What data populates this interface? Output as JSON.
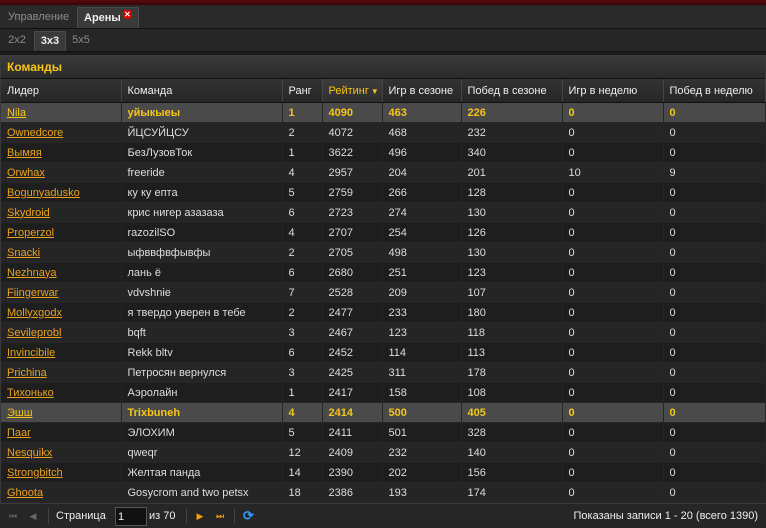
{
  "tabs": [
    {
      "label": "Управление"
    },
    {
      "label": "Арены",
      "closable": true
    }
  ],
  "subtabs": [
    "2x2",
    "3x3",
    "5x5"
  ],
  "active_subtab": "3x3",
  "panel_title": "Команды",
  "columns": [
    "Лидер",
    "Команда",
    "Ранг",
    "Рейтинг",
    "Игр в сезоне",
    "Побед в сезоне",
    "Игр в неделю",
    "Побед в неделю"
  ],
  "sorted_column": "Рейтинг",
  "rows": [
    {
      "leader": "Nila",
      "team": "уйыкыеы",
      "rank": "1",
      "rating": "4090",
      "season_games": "463",
      "season_wins": "226",
      "week_games": "0",
      "week_wins": "0",
      "highlight": true
    },
    {
      "leader": "Ownedcore",
      "team": "ЙЦСУЙЦСУ",
      "rank": "2",
      "rating": "4072",
      "season_games": "468",
      "season_wins": "232",
      "week_games": "0",
      "week_wins": "0"
    },
    {
      "leader": "Вымяя",
      "team": "БезЛузовТок",
      "rank": "1",
      "rating": "3622",
      "season_games": "496",
      "season_wins": "340",
      "week_games": "0",
      "week_wins": "0"
    },
    {
      "leader": "Orwhax",
      "team": "freeride",
      "rank": "4",
      "rating": "2957",
      "season_games": "204",
      "season_wins": "201",
      "week_games": "10",
      "week_wins": "9"
    },
    {
      "leader": "Bogunyadusko",
      "team": "ку ку епта",
      "rank": "5",
      "rating": "2759",
      "season_games": "266",
      "season_wins": "128",
      "week_games": "0",
      "week_wins": "0"
    },
    {
      "leader": "Skydroid",
      "team": "крис нигер азазаза",
      "rank": "6",
      "rating": "2723",
      "season_games": "274",
      "season_wins": "130",
      "week_games": "0",
      "week_wins": "0"
    },
    {
      "leader": "Properzol",
      "team": "razozilSO",
      "rank": "4",
      "rating": "2707",
      "season_games": "254",
      "season_wins": "126",
      "week_games": "0",
      "week_wins": "0"
    },
    {
      "leader": "Snacki",
      "team": "ыфввфвфывфы",
      "rank": "2",
      "rating": "2705",
      "season_games": "498",
      "season_wins": "130",
      "week_games": "0",
      "week_wins": "0"
    },
    {
      "leader": "Nezhnaya",
      "team": "лань ё",
      "rank": "6",
      "rating": "2680",
      "season_games": "251",
      "season_wins": "123",
      "week_games": "0",
      "week_wins": "0"
    },
    {
      "leader": "Fiingerwar",
      "team": "vdvshnie",
      "rank": "7",
      "rating": "2528",
      "season_games": "209",
      "season_wins": "107",
      "week_games": "0",
      "week_wins": "0"
    },
    {
      "leader": "Mollyxgodx",
      "team": "я твердо уверен в тебе",
      "rank": "2",
      "rating": "2477",
      "season_games": "233",
      "season_wins": "180",
      "week_games": "0",
      "week_wins": "0"
    },
    {
      "leader": "Sevileprobl",
      "team": "bqft",
      "rank": "3",
      "rating": "2467",
      "season_games": "123",
      "season_wins": "118",
      "week_games": "0",
      "week_wins": "0"
    },
    {
      "leader": "Invincibile",
      "team": "Rekk bltv",
      "rank": "6",
      "rating": "2452",
      "season_games": "114",
      "season_wins": "113",
      "week_games": "0",
      "week_wins": "0"
    },
    {
      "leader": "Prichina",
      "team": "Петросян вернулся",
      "rank": "3",
      "rating": "2425",
      "season_games": "311",
      "season_wins": "178",
      "week_games": "0",
      "week_wins": "0"
    },
    {
      "leader": "Тихонько",
      "team": "Аэролайн",
      "rank": "1",
      "rating": "2417",
      "season_games": "158",
      "season_wins": "108",
      "week_games": "0",
      "week_wins": "0"
    },
    {
      "leader": "Эшш",
      "team": "Trixbuneh",
      "rank": "4",
      "rating": "2414",
      "season_games": "500",
      "season_wins": "405",
      "week_games": "0",
      "week_wins": "0",
      "highlight": true
    },
    {
      "leader": "Паar",
      "team": "ЭЛОХИМ",
      "rank": "5",
      "rating": "2411",
      "season_games": "501",
      "season_wins": "328",
      "week_games": "0",
      "week_wins": "0"
    },
    {
      "leader": "Nesquikx",
      "team": "qweqr",
      "rank": "12",
      "rating": "2409",
      "season_games": "232",
      "season_wins": "140",
      "week_games": "0",
      "week_wins": "0"
    },
    {
      "leader": "Strongbitch",
      "team": "Желтая панда",
      "rank": "14",
      "rating": "2390",
      "season_games": "202",
      "season_wins": "156",
      "week_games": "0",
      "week_wins": "0"
    },
    {
      "leader": "Ghoota",
      "team": "Gosycrom and two petsx",
      "rank": "18",
      "rating": "2386",
      "season_games": "193",
      "season_wins": "174",
      "week_games": "0",
      "week_wins": "0"
    }
  ],
  "pager": {
    "page_label": "Страница",
    "page_value": "1",
    "of_label": "из 70",
    "status": "Показаны записи 1 - 20 (всего 1390)"
  },
  "colors": {
    "accent": "#f5c518",
    "link": "#e8a020",
    "refresh": "#3399ff",
    "close": "#cc0000"
  }
}
